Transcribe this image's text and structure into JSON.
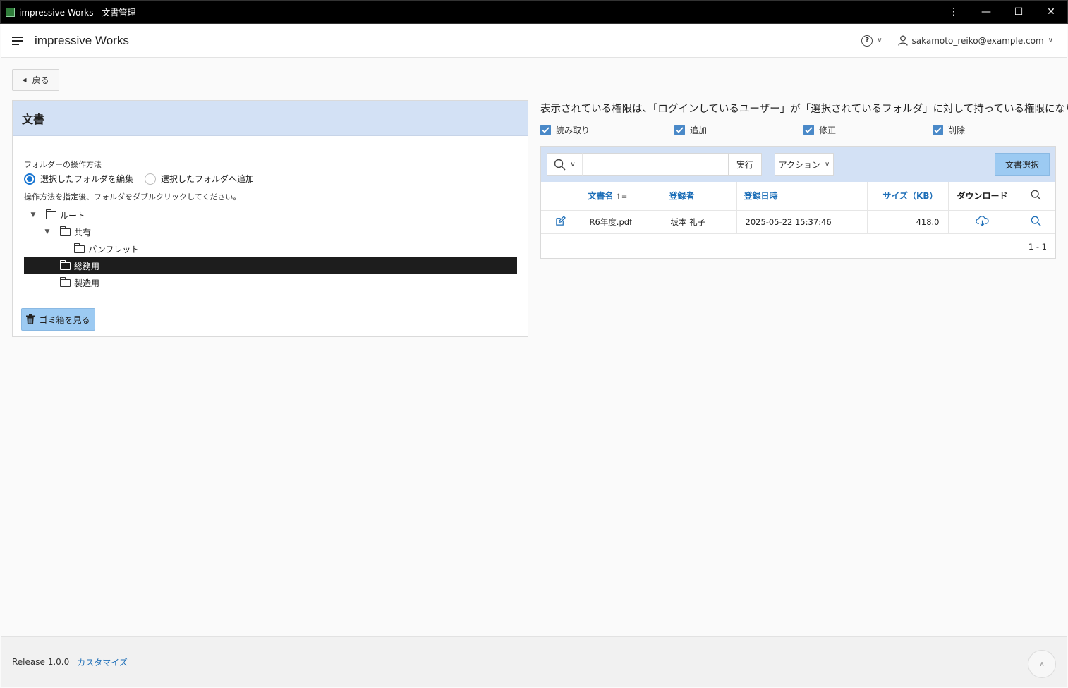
{
  "window": {
    "title": "impressive Works - 文書管理",
    "controls": {
      "menu": "⋮",
      "minimize": "—",
      "maximize": "☐",
      "close": "✕"
    }
  },
  "header": {
    "brand": "impressive Works",
    "user_email": "sakamoto_reiko@example.com"
  },
  "back_label": "戻る",
  "doc_panel": {
    "title": "文書",
    "op_label": "フォルダーの操作方法",
    "radio_edit": "選択したフォルダを編集",
    "radio_add": "選択したフォルダへ追加",
    "hint": "操作方法を指定後、フォルダをダブルクリックしてください。",
    "tree": [
      {
        "label": "ルート",
        "level": 0,
        "expanded": true,
        "selected": false
      },
      {
        "label": "共有",
        "level": 1,
        "expanded": true,
        "selected": false
      },
      {
        "label": "パンフレット",
        "level": 2,
        "expanded": false,
        "selected": false
      },
      {
        "label": "総務用",
        "level": 1,
        "expanded": false,
        "selected": true
      },
      {
        "label": "製造用",
        "level": 1,
        "expanded": false,
        "selected": false
      }
    ],
    "trash_label": "ゴミ箱を見る"
  },
  "permissions": {
    "note": "表示されている権限は、「ログインしているユーザー」が「選択されているフォルダ」に対して持っている権限になります。",
    "read": "読み取り",
    "add": "追加",
    "modify": "修正",
    "delete": "削除"
  },
  "grid": {
    "exec_label": "実行",
    "action_label": "アクション",
    "select_doc_label": "文書選択",
    "columns": {
      "name": "文書名",
      "registrant": "登録者",
      "registered_at": "登録日時",
      "size": "サイズ（KB）",
      "download": "ダウンロード"
    },
    "rows": [
      {
        "name": "R6年度.pdf",
        "registrant": "坂本 礼子",
        "registered_at": "2025-05-22 15:37:46",
        "size": "418.0"
      }
    ],
    "pager": "1 - 1"
  },
  "footer": {
    "release": "Release 1.0.0",
    "customize": "カスタマイズ"
  },
  "colors": {
    "accent": "#1976d2",
    "panel_header": "#d3e1f5",
    "primary_button": "#9ccaf2",
    "link": "#1e6fb8"
  }
}
